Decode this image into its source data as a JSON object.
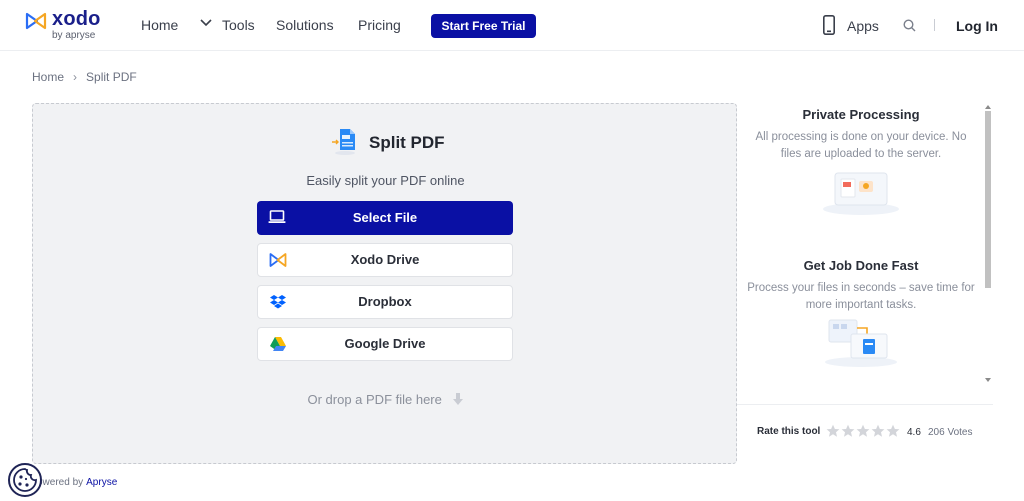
{
  "header": {
    "logo_word": "xodo",
    "logo_sub": "by apryse",
    "nav": {
      "home": "Home",
      "tools": "Tools",
      "solutions": "Solutions",
      "pricing": "Pricing"
    },
    "cta_label": "Start Free Trial",
    "apps_label": "Apps",
    "login_label": "Log In"
  },
  "breadcrumb": {
    "items": [
      "Home",
      "Split PDF"
    ],
    "separator": "›"
  },
  "tool": {
    "title": "Split PDF",
    "subtitle": "Easily split your PDF online",
    "buttons": {
      "select_file": "Select File",
      "xodo_drive": "Xodo Drive",
      "dropbox": "Dropbox",
      "google_drive": "Google Drive"
    },
    "drop_text": "Or drop a PDF file here"
  },
  "features": [
    {
      "title": "Private Processing",
      "text": "All processing is done on your device. No files are uploaded to the server."
    },
    {
      "title": "Get Job Done Fast",
      "text": "Process your files in seconds – save time for more important tasks."
    }
  ],
  "rating": {
    "label": "Rate this tool",
    "score": "4.6",
    "votes": "206 Votes",
    "stars_total": 5,
    "stars_filled": 0
  },
  "footer": {
    "powered_prefix": "owered by",
    "powered_brand": "Apryse"
  },
  "colors": {
    "brand": "#0a10a4",
    "card_bg": "#f1f2f4",
    "dropbox": "#0061fe",
    "star_empty": "#d3d5da"
  },
  "icons": [
    "xodo-logo-icon",
    "chevron-down-icon",
    "phone-icon",
    "search-icon",
    "split-pdf-icon",
    "laptop-icon",
    "xodo-drive-icon",
    "dropbox-icon",
    "google-drive-icon",
    "down-arrow-icon",
    "star-icon",
    "cookie-icon"
  ]
}
